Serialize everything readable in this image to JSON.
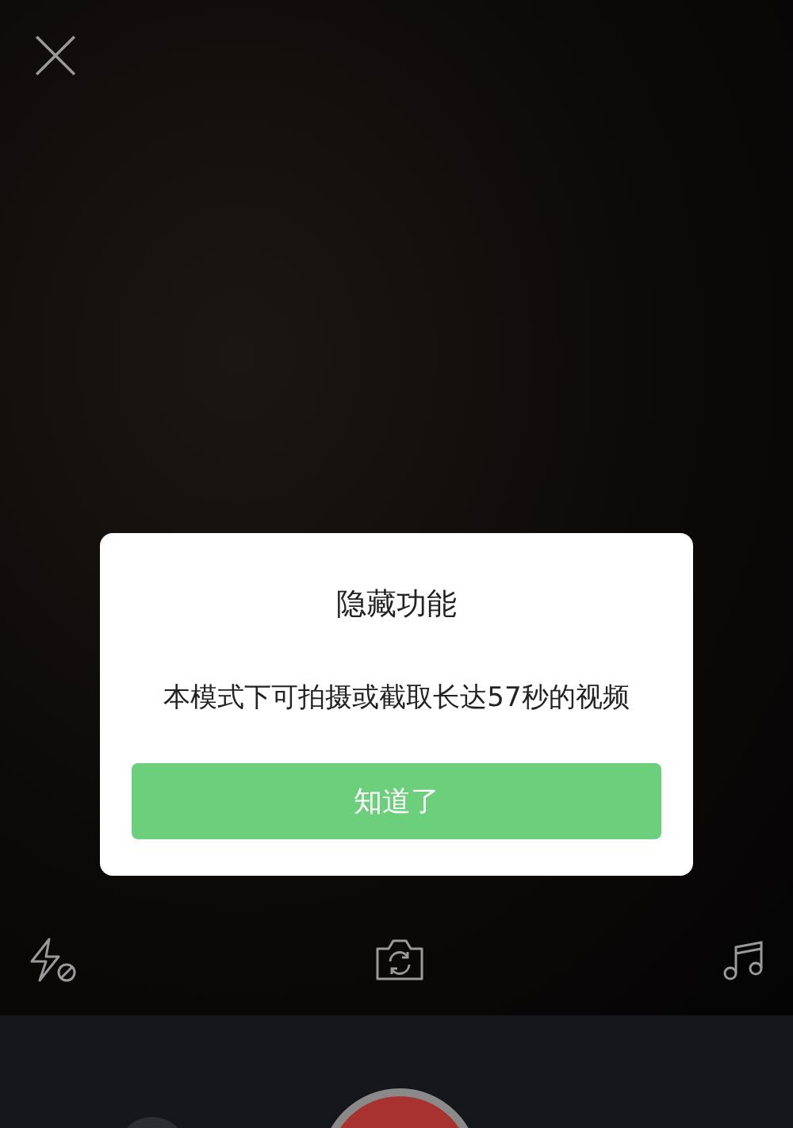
{
  "dialog": {
    "title": "隐藏功能",
    "message": "本模式下可拍摄或截取长达57秒的视频",
    "button": "知道了"
  }
}
